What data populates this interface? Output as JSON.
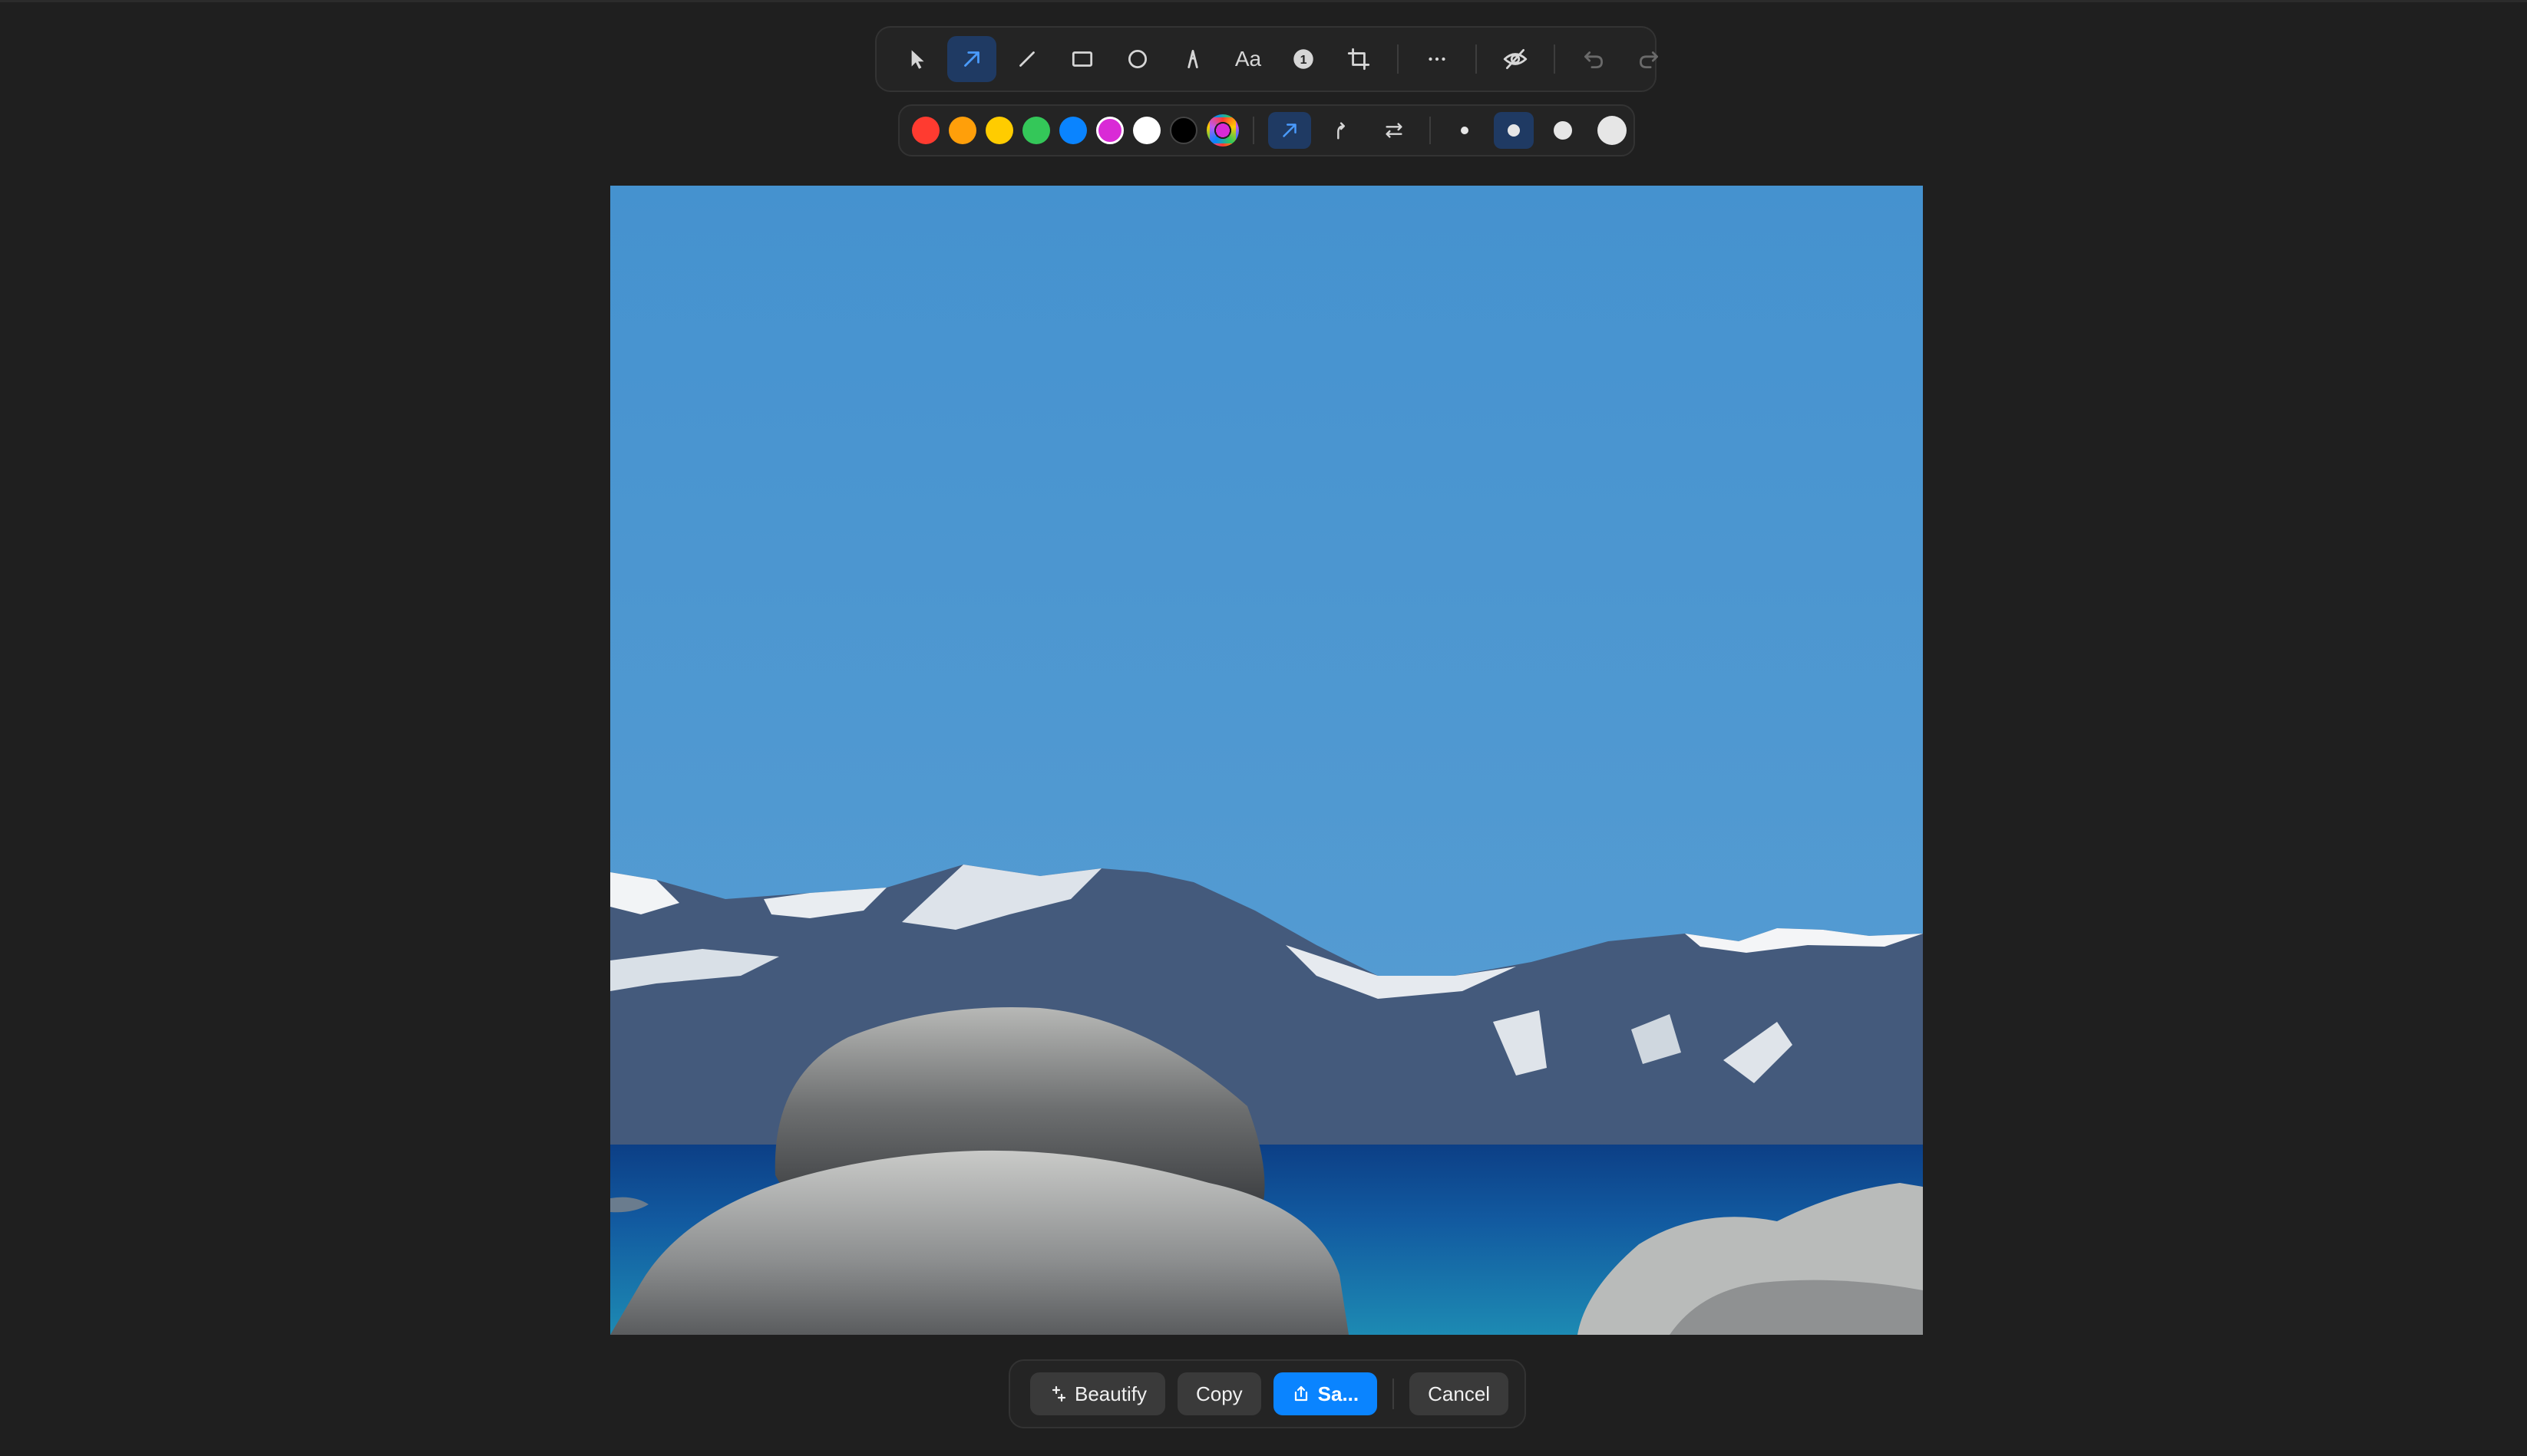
{
  "toolbar": {
    "tools": [
      {
        "id": "select",
        "icon": "pointer-icon"
      },
      {
        "id": "arrow",
        "icon": "arrow-icon",
        "active": true
      },
      {
        "id": "line",
        "icon": "line-icon"
      },
      {
        "id": "rectangle",
        "icon": "rectangle-icon"
      },
      {
        "id": "ellipse",
        "icon": "ellipse-icon"
      },
      {
        "id": "pen",
        "icon": "pen-icon"
      },
      {
        "id": "text",
        "icon": "text-icon",
        "label": "Aa"
      },
      {
        "id": "counter",
        "icon": "counter-icon",
        "label": "1"
      },
      {
        "id": "crop",
        "icon": "crop-icon"
      },
      {
        "id": "more",
        "icon": "more-icon"
      },
      {
        "id": "redact",
        "icon": "eye-slash-icon"
      },
      {
        "id": "undo",
        "icon": "undo-icon"
      },
      {
        "id": "redo",
        "icon": "redo-icon"
      }
    ]
  },
  "stylebar": {
    "colors": [
      "#ff3b30",
      "#ff9f0a",
      "#ffcc00",
      "#34c759",
      "#0a84ff",
      "#d92ad6",
      "#ffffff",
      "#000000"
    ],
    "custom_color": "#d92ad6",
    "arrow_styles": [
      {
        "id": "straight",
        "icon": "arrow-straight-icon",
        "active": true
      },
      {
        "id": "curved",
        "icon": "arrow-curved-icon"
      },
      {
        "id": "double",
        "icon": "arrow-double-icon"
      }
    ],
    "sizes": [
      {
        "id": "small"
      },
      {
        "id": "medium",
        "active": true
      },
      {
        "id": "large"
      },
      {
        "id": "xlarge"
      }
    ]
  },
  "actions": {
    "beautify": "Beautify",
    "copy": "Copy",
    "save": "Sa...",
    "cancel": "Cancel"
  },
  "accent_color": "#0a84ff"
}
